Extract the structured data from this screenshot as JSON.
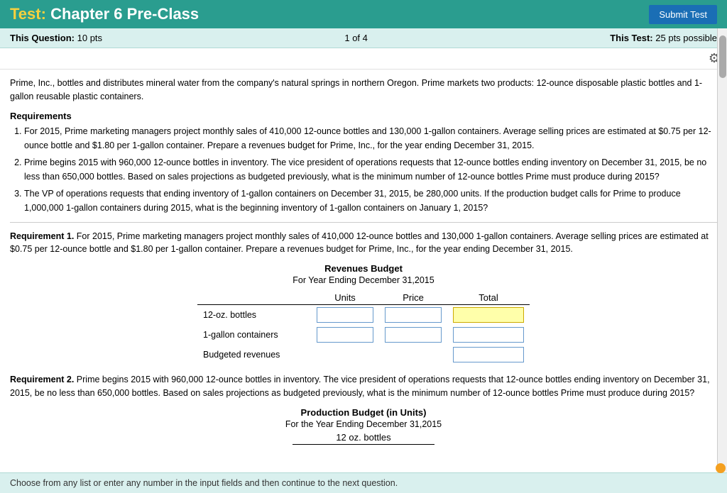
{
  "header": {
    "test_label": "Test:",
    "title": "Chapter 6 Pre-Class",
    "submit_button": "Submit Test"
  },
  "sub_header": {
    "question_label": "This Question:",
    "question_pts": "10 pts",
    "page_current": "1",
    "page_total": "4",
    "page_separator": "of",
    "test_label": "This Test:",
    "test_pts": "25 pts possible"
  },
  "scenario": {
    "text": "Prime, Inc., bottles and distributes mineral water from the company's natural springs in northern Oregon. Prime markets two products: 12-ounce disposable plastic bottles and 1-gallon reusable plastic containers."
  },
  "requirements_header": "Requirements",
  "requirements": [
    {
      "id": 1,
      "text": "For 2015, Prime marketing managers project monthly sales of 410,000 12-ounce bottles and 130,000 1-gallon containers. Average selling prices are estimated at $0.75 per 12-ounce bottle and $1.80 per 1-gallon container. Prepare a revenues budget for Prime, Inc., for the year ending December 31, 2015."
    },
    {
      "id": 2,
      "text": "Prime begins 2015 with 960,000 12-ounce bottles in inventory. The vice president of operations requests that 12-ounce bottles ending inventory on December 31, 2015, be no less than 650,000 bottles. Based on sales projections as budgeted previously, what is the minimum number of 12-ounce bottles Prime must produce during 2015?"
    },
    {
      "id": 3,
      "text": "The VP of operations requests that ending inventory of 1-gallon containers on December 31, 2015, be 280,000 units. If the production budget calls for Prime to produce 1,000,000 1-gallon containers during 2015, what is the beginning inventory of 1-gallon containers on January 1, 2015?"
    }
  ],
  "req1_block": {
    "label": "Requirement 1.",
    "text": "For 2015, Prime marketing managers project monthly sales of 410,000 12-ounce bottles and 130,000 1-gallon containers. Average selling prices are estimated at $0.75 per 12-ounce bottle and $1.80 per 1-gallon container. Prepare a revenues budget for Prime, Inc., for the year ending December 31, 2015."
  },
  "revenues_budget": {
    "title": "Revenues Budget",
    "subtitle": "For Year Ending December 31,2015",
    "col_units": "Units",
    "col_price": "Price",
    "col_total": "Total",
    "rows": [
      {
        "label": "12-oz. bottles"
      },
      {
        "label": "1-gallon containers"
      },
      {
        "label": "Budgeted revenues"
      }
    ]
  },
  "req2_block": {
    "label": "Requirement 2.",
    "text": "Prime begins 2015 with 960,000 12-ounce bottles in inventory. The vice president of operations requests that 12-ounce bottles ending inventory on December 31, 2015, be no less than 650,000 bottles. Based on sales projections as budgeted previously, what is the minimum number of 12-ounce bottles Prime must produce during 2015?"
  },
  "production_budget": {
    "title": "Production Budget (in Units)",
    "subtitle": "For the Year Ending December 31,2015",
    "col_header": "12 oz. bottles"
  },
  "bottom_bar": {
    "text": "Choose from any list or enter any number in the input fields and then continue to the next question."
  }
}
